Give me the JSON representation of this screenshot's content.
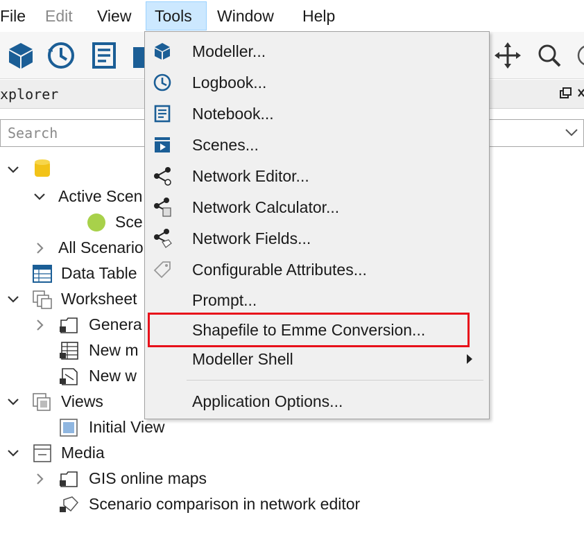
{
  "menubar": {
    "items": [
      {
        "label": "File",
        "state": "normal"
      },
      {
        "label": "Edit",
        "state": "disabled"
      },
      {
        "label": "View",
        "state": "normal"
      },
      {
        "label": "Tools",
        "state": "active"
      },
      {
        "label": "Window",
        "state": "normal"
      },
      {
        "label": "Help",
        "state": "normal"
      }
    ]
  },
  "toolbar": {
    "icons": [
      "modeller-cube-icon",
      "logbook-clock-icon",
      "notebook-icon",
      "scenes-icon",
      "pan-move-icon",
      "zoom-search-icon",
      "circle-icon"
    ]
  },
  "explorer": {
    "title": "xplorer",
    "search_placeholder": "Search"
  },
  "tree": {
    "active_scenario": "Active Scen",
    "scenario_item": "Sce",
    "all_scenarios": "All Scenario",
    "data_tables": "Data Table",
    "worksheets": "Worksheet",
    "general": "Genera",
    "new_map": "New m",
    "new_worksheet": "New w",
    "views": "Views",
    "initial_view": "Initial View",
    "media": "Media",
    "gis_online_maps": "GIS online maps",
    "scenario_comparison": "Scenario comparison in network editor"
  },
  "tools_menu": {
    "items": [
      {
        "label": "Modeller...",
        "icon": "modeller-cube-icon"
      },
      {
        "label": "Logbook...",
        "icon": "logbook-clock-icon"
      },
      {
        "label": "Notebook...",
        "icon": "notebook-icon"
      },
      {
        "label": "Scenes...",
        "icon": "scenes-icon"
      },
      {
        "label": "Network Editor...",
        "icon": "network-editor-icon"
      },
      {
        "label": "Network Calculator...",
        "icon": "network-calculator-icon"
      },
      {
        "label": "Network Fields...",
        "icon": "network-fields-icon"
      },
      {
        "label": "Configurable Attributes...",
        "icon": "tag-icon"
      },
      {
        "label": "Prompt...",
        "icon": ""
      },
      {
        "label": "Shapefile to Emme Conversion...",
        "icon": "",
        "highlighted": true
      },
      {
        "label": "Modeller Shell",
        "icon": "",
        "submenu": true
      },
      {
        "label": "Application Options...",
        "icon": ""
      }
    ]
  },
  "colors": {
    "highlight_border": "#e8101a",
    "menu_active_bg": "#cce8ff",
    "icon_blue": "#1b5e96",
    "scenario_green": "#a8d14a",
    "db_yellow": "#f2c318"
  }
}
